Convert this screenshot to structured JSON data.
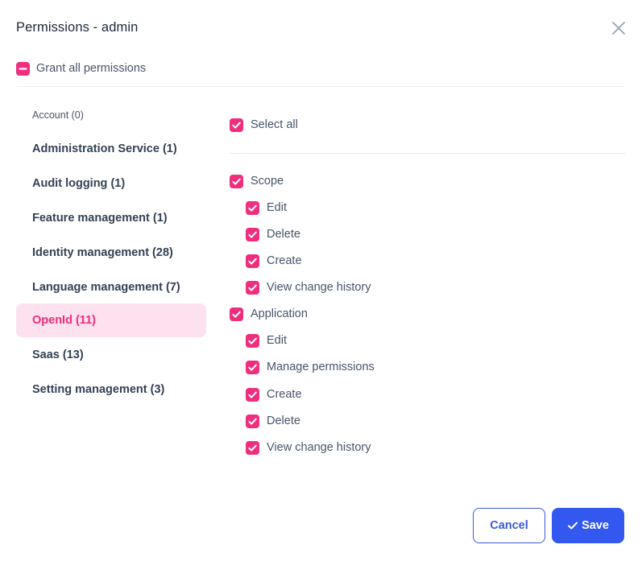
{
  "dialog": {
    "title": "Permissions - admin",
    "grant_all_label": "Grant all permissions"
  },
  "sidebar": {
    "items": [
      {
        "label": "Account (0)",
        "style": "small"
      },
      {
        "label": "Administration Service (1)"
      },
      {
        "label": "Audit logging (1)"
      },
      {
        "label": "Feature management (1)"
      },
      {
        "label": "Identity management (28)"
      },
      {
        "label": "Language management (7)"
      },
      {
        "label": "OpenId (11)",
        "active": true
      },
      {
        "label": "Saas (13)"
      },
      {
        "label": "Setting management (3)"
      }
    ]
  },
  "panel": {
    "select_all_label": "Select all",
    "groups": [
      {
        "label": "Scope",
        "items": [
          "Edit",
          "Delete",
          "Create",
          "View change history"
        ]
      },
      {
        "label": "Application",
        "items": [
          "Edit",
          "Manage permissions",
          "Create",
          "Delete",
          "View change history"
        ]
      }
    ]
  },
  "footer": {
    "cancel_label": "Cancel",
    "save_label": "Save"
  },
  "colors": {
    "accent_pink": "#ef2f7e",
    "active_bg": "#fde1ee",
    "primary_blue": "#3358f0"
  },
  "icons": {
    "close": "close-icon",
    "check": "check-icon",
    "indeterminate": "minus-icon"
  }
}
